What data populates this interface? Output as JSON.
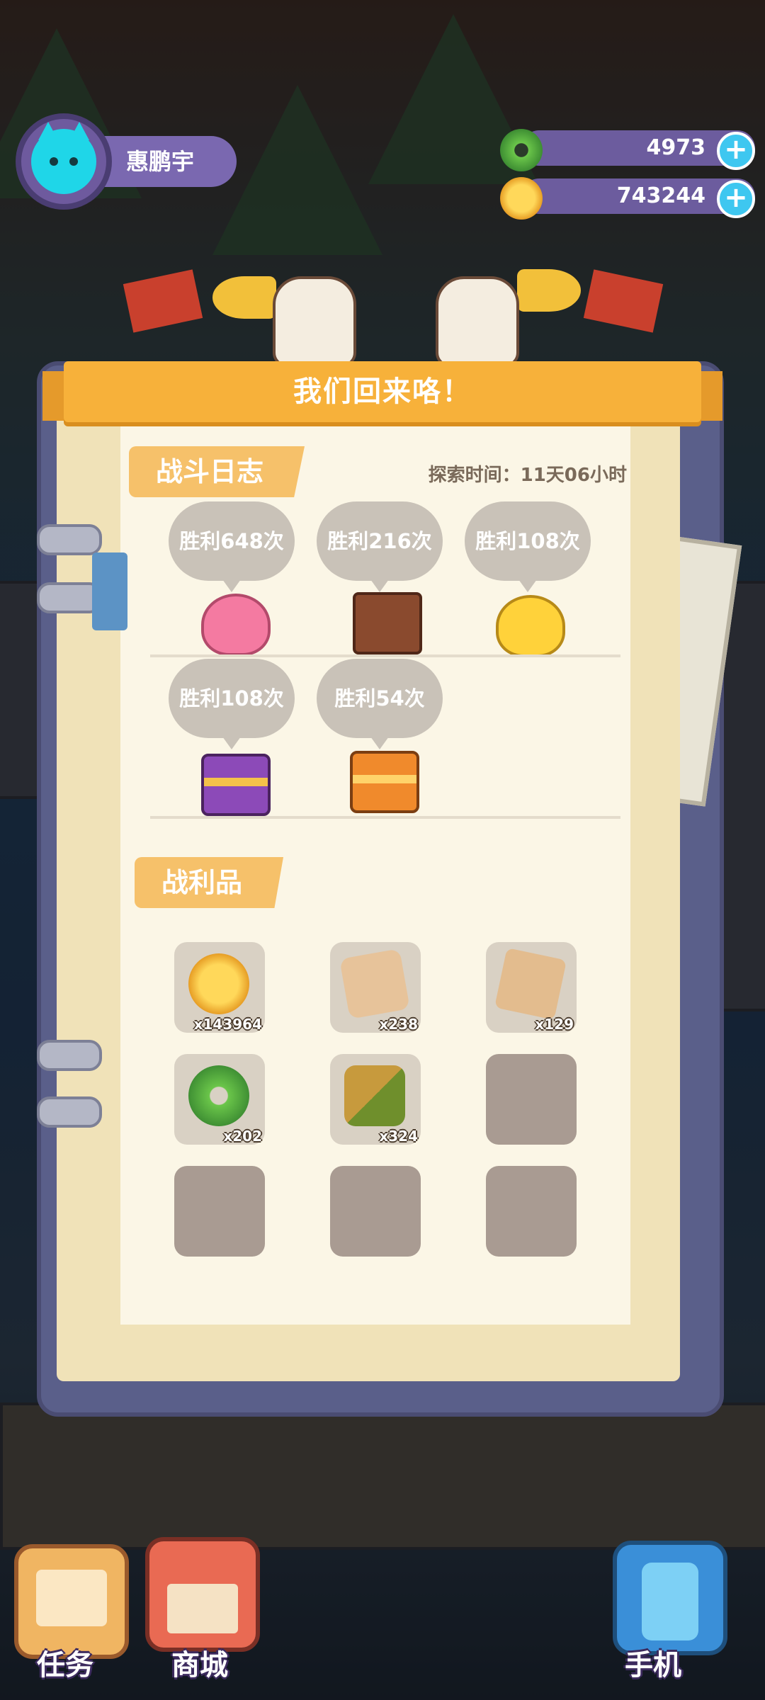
{
  "player": {
    "name": "惠鹏宇",
    "avatar_icon": "cat-avatar-icon"
  },
  "currency": [
    {
      "icon": "green-donut-icon",
      "value": "4973",
      "color": "#5bb84a"
    },
    {
      "icon": "gold-planet-coin-icon",
      "value": "743244",
      "color": "#f5b82a"
    }
  ],
  "dialog": {
    "title": "我们回来咯！",
    "battle_log": {
      "heading": "战斗日志",
      "explore_time": "探索时间：11天06小时",
      "victories": [
        {
          "label": "胜利648次",
          "monster": "pink-slime-icon"
        },
        {
          "label": "胜利216次",
          "monster": "treasure-mimic-icon"
        },
        {
          "label": "胜利108次",
          "monster": "yellow-slime-icon"
        },
        {
          "label": "胜利108次",
          "monster": "purple-chest-monster-icon"
        },
        {
          "label": "胜利54次",
          "monster": "orange-chest-monster-icon"
        }
      ]
    },
    "loot": {
      "heading": "战利品",
      "items": [
        {
          "icon": "gold-coin-icon",
          "count": "x143964"
        },
        {
          "icon": "map-scroll-icon",
          "count": "x238"
        },
        {
          "icon": "map-fragment-icon",
          "count": "x129"
        },
        {
          "icon": "green-donut-icon",
          "count": "x202"
        },
        {
          "icon": "wood-log-icon",
          "count": "x324"
        },
        {
          "icon": "empty-slot",
          "count": ""
        },
        {
          "icon": "empty-slot",
          "count": ""
        },
        {
          "icon": "empty-slot",
          "count": ""
        },
        {
          "icon": "empty-slot",
          "count": ""
        }
      ]
    }
  },
  "nav": {
    "tasks": "任务",
    "shop": "商城",
    "phone": "手机"
  }
}
